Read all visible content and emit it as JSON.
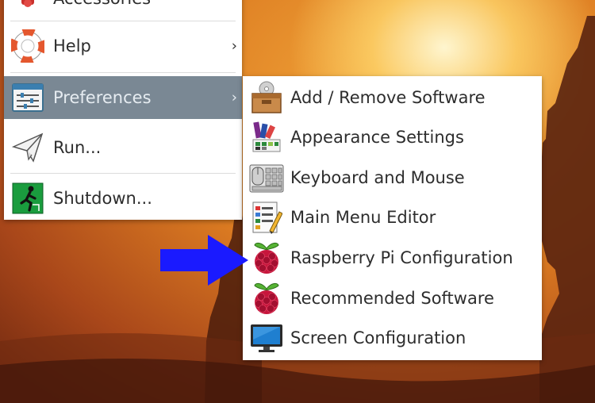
{
  "main_menu": {
    "items": [
      {
        "label": "Accessories",
        "icon": "accessories-icon"
      },
      {
        "label": "Help",
        "icon": "lifebuoy-icon"
      },
      {
        "label": "Preferences",
        "icon": "preferences-icon"
      },
      {
        "label": "Run...",
        "icon": "paper-plane-icon"
      },
      {
        "label": "Shutdown...",
        "icon": "exit-icon"
      }
    ]
  },
  "submenu": {
    "items": [
      {
        "label": "Add / Remove Software",
        "icon": "package-icon"
      },
      {
        "label": "Appearance Settings",
        "icon": "palette-icon"
      },
      {
        "label": "Keyboard and Mouse",
        "icon": "keyboard-mouse-icon"
      },
      {
        "label": "Main Menu Editor",
        "icon": "menu-editor-icon"
      },
      {
        "label": "Raspberry Pi Configuration",
        "icon": "raspberry-icon"
      },
      {
        "label": "Recommended Software",
        "icon": "raspberry-icon"
      },
      {
        "label": "Screen Configuration",
        "icon": "monitor-icon"
      }
    ]
  },
  "colors": {
    "selected_background": "#7a8894",
    "pointer_arrow": "#1a1aff"
  }
}
